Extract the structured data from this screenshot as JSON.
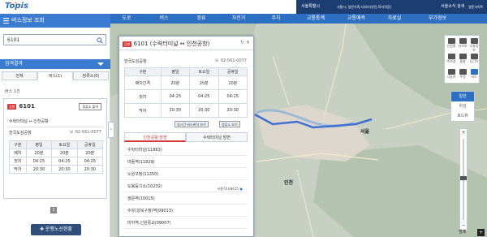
{
  "header": {
    "logo": "Topis",
    "nav": [
      "도로",
      "버스",
      "정류",
      "자전거",
      "주차",
      "교통통계",
      "교통예측",
      "자료실",
      "부가정보"
    ],
    "seoul": "서울특별시",
    "seoul_links": "서울시, 일반가족,다자녀(유턴,학자격증)",
    "right_links": [
      "서울소식",
      "검색",
      "영문사이트"
    ]
  },
  "main_nav": [
    "도로",
    "버스",
    "정류",
    "자전거",
    "주차",
    "교통통계",
    "교통예측",
    "자료실",
    "부가정보"
  ],
  "left_panel": {
    "title": "버스정보 조회",
    "search_value": "6101",
    "results_label": "검색결과",
    "tabs": [
      "전체",
      "버스(1)",
      "정류소(0)"
    ],
    "count_label": "버스 1건",
    "card": {
      "badge": "공항",
      "number": "6101",
      "stop_button": "정류소 출력",
      "route": "수락터미널 ↔ 인천공항",
      "company": "한국도심공항",
      "tel": "02-561-0077",
      "headers": [
        "구분",
        "평일",
        "토요일",
        "공휴일"
      ],
      "rows": [
        [
          "배차",
          "20분",
          "20분",
          "20분"
        ],
        [
          "첫차",
          "04:25",
          "04:25",
          "04:25"
        ],
        [
          "막차",
          "20:30",
          "20:30",
          "20:30"
        ]
      ]
    },
    "page": "1",
    "route_button": "운행노선현황"
  },
  "popup": {
    "badge": "공항",
    "title": "6101 (수락터미널 ↔ 인천공항)",
    "company": "한국도심공항",
    "tel": "02-561-0077",
    "headers": [
      "구분",
      "평일",
      "토요일",
      "공휴일"
    ],
    "rows": [
      [
        "배차간격",
        "20분",
        "20분",
        "20분"
      ],
      [
        "첫차",
        "04:25",
        "04:25",
        "04:25"
      ],
      [
        "막차",
        "20:30",
        "20:30",
        "20:30"
      ]
    ],
    "btn_realtime": "실시간 버스위치 보기",
    "btn_stops": "정류소 보기",
    "tabs": [
      "인천공항 방면",
      "수락터미널 방면"
    ],
    "stops": [
      {
        "name": "수락터미널(11863)",
        "bus": ""
      },
      {
        "name": "마들역(11829)",
        "bus": ""
      },
      {
        "name": "노원구청(11250)",
        "bus": ""
      },
      {
        "name": "도봉등기소(10232)",
        "bus": "서울70사8415"
      },
      {
        "name": "쌍문역(10015)",
        "bus": ""
      },
      {
        "name": "수유(강북구청)역(09013)",
        "bus": ""
      },
      {
        "name": "미아역.신원중교(09007)",
        "bus": ""
      }
    ]
  },
  "map": {
    "tools": [
      "인정항",
      "자치보",
      "소통정보",
      "주차장",
      "돌발",
      "CCTV",
      "나눔카",
      "주정",
      "버스"
    ],
    "layers": [
      "일반",
      "위성",
      "로드뷰"
    ],
    "places": [
      "서울",
      "인천"
    ],
    "scale": "범례"
  }
}
